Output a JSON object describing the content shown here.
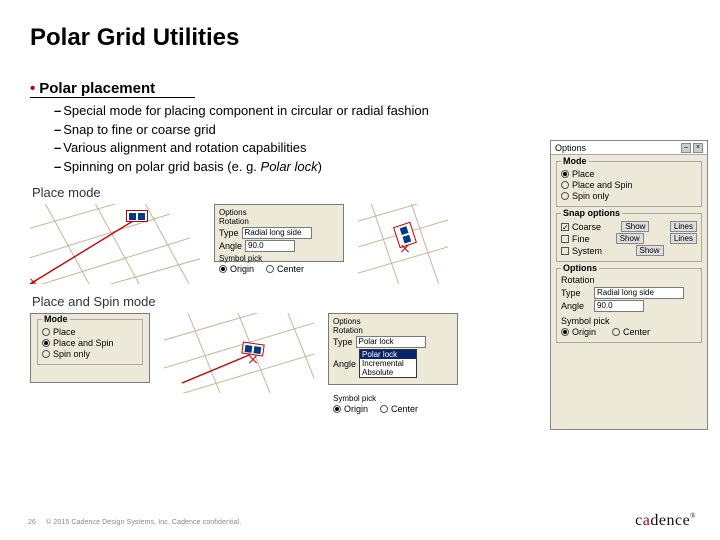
{
  "title": "Polar Grid Utilities",
  "section": "Polar placement",
  "bullets": {
    "b1": "Special mode for placing component in circular or  radial fashion",
    "b2": "Snap to fine or coarse grid",
    "b3": "Various alignment and rotation capabilities",
    "b4_pre": "Spinning on polar grid basis (e. g. ",
    "b4_em": "Polar lock",
    "b4_post": ")"
  },
  "labels": {
    "place_mode": "Place mode",
    "place_spin_mode": "Place and Spin mode"
  },
  "panels": {
    "options_title": "Options",
    "rotation_title": "Rotation",
    "type_lbl": "Type",
    "angle_lbl": "Angle",
    "sym_pick_title": "Symbol pick",
    "origin_lbl": "Origin",
    "center_lbl": "Center",
    "type_radial": "Radial long side",
    "angle_90": "90.0",
    "type_polar": "Polar lock",
    "opt0": "Polar lock",
    "opt1": "Incremental",
    "opt2": "Absolute",
    "mode_title": "Mode",
    "mode_place": "Place",
    "mode_place_spin": "Place and Spin",
    "mode_spin": "Spin only",
    "snap_title": "Snap options",
    "coarse": "Coarse",
    "fine": "Fine",
    "system": "System",
    "show": "Show",
    "lines": "Lines",
    "radial_long": "Radial long side"
  },
  "footer": {
    "page": "26",
    "copyright": "© 2015 Cadence Design Systems, Inc. Cadence confidential."
  },
  "logo": {
    "pre": "c",
    "accent": "a",
    "post": "dence",
    "reg": "®"
  }
}
